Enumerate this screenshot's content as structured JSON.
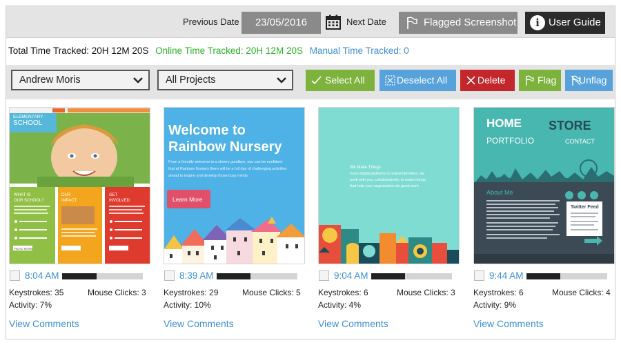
{
  "topbar": {
    "previous_label": "Previous Date",
    "date_value": "23/05/2016",
    "next_label": "Next Date",
    "flagged_label": "Flagged Screenshot",
    "guide_label": "User Guide",
    "guide_icon_glyph": "i"
  },
  "totals": {
    "total": "Total Time Tracked: 20H 12M 20S",
    "online": "Online Time Tracked: 20H 12M 20S",
    "manual": "Manual Time Tracked: 0"
  },
  "colors": {
    "online": "#27b327",
    "manual": "#3d8fd6",
    "select_all": "#7db23d",
    "deselect_all": "#58a2dc",
    "delete": "#c3272b"
  },
  "controls": {
    "user_select": "Andrew Moris",
    "project_select": "All Projects",
    "select_all": "Select All",
    "deselect_all": "Deselect All",
    "delete": "Delete",
    "flag": "Flag",
    "unflag": "Unflag"
  },
  "screenshots": [
    {
      "time": "8:04 AM",
      "activity_level": 0.43,
      "keystrokes": "Keystrokes: 35",
      "mouse_clicks": "Mouse Clicks: 3",
      "activity": "Activity: 7%",
      "comments": "View Comments",
      "thumb": {
        "header_line1": "ELEMENTARY",
        "header_line2": "SCHOOL",
        "tile1_a": "WHAT IS",
        "tile1_b": "OUR SCHOOL?",
        "tile2_a": "OUR",
        "tile2_b": "IMPACT",
        "tile3_a": "GET",
        "tile3_b": "INVOLVED",
        "read_more": "READ MORE"
      }
    },
    {
      "time": "8:39 AM",
      "activity_level": 0.42,
      "keystrokes": "Keystrokes: 29",
      "mouse_clicks": "Mouse Clicks: 5",
      "activity": "Activity: 10%",
      "comments": "View Comments",
      "thumb": {
        "line1": "Welcome to",
        "line2": "Rainbow Nursery",
        "body1": "From a friendly welcome to a cheery goodbye, you can be confident",
        "body2": "that at Rainbow Nursery there will be a full day of challenging activities",
        "body3": "ahead to inspire and develop those busy minds.",
        "button": "Learn More"
      }
    },
    {
      "time": "9:04 AM",
      "activity_level": 0.42,
      "keystrokes": "Keystrokes: 6",
      "mouse_clicks": "Mouse Clicks: 3",
      "activity": "Activity: 4%",
      "comments": "View Comments",
      "thumb": {
        "heading": "We Make Things",
        "body1": "From digital platforms to brand identities, we",
        "body2": "work with you, collaboratively, to make things",
        "body3": "that help your organisation do great work."
      }
    },
    {
      "time": "9:44 AM",
      "activity_level": 0.42,
      "keystrokes": "Keystrokes: 6",
      "mouse_clicks": "Mouse Clicks: 4",
      "activity": "Activity: 9%",
      "comments": "View Comments",
      "thumb": {
        "home": "HOME",
        "portfolio": "PORTFOLIO",
        "store": "STORE",
        "contact": "CONTACT",
        "about": "About Me",
        "feed": "Twitter Feed"
      }
    }
  ]
}
